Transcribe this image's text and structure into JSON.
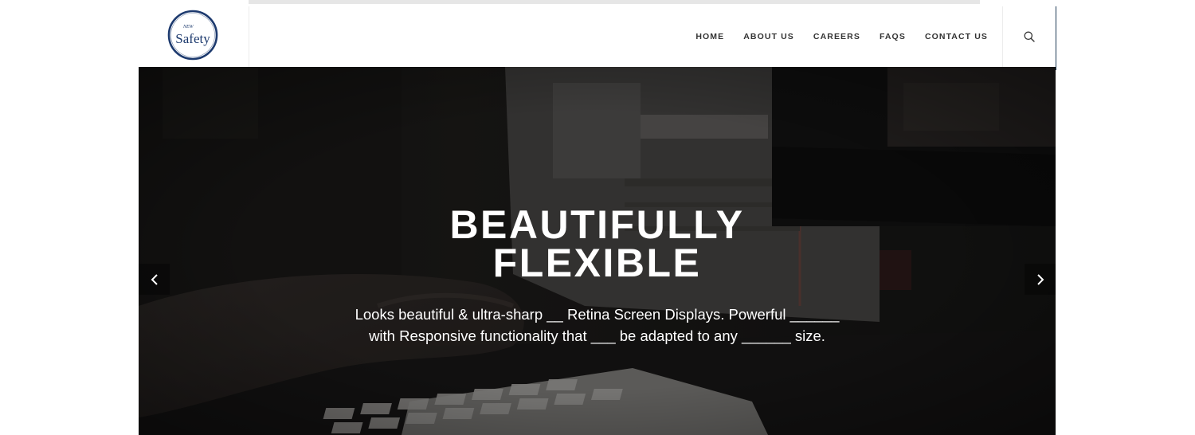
{
  "brand": {
    "logo_small_text": "NEW",
    "logo_text": "Safety",
    "logo_color": "#1d3a6e"
  },
  "nav": {
    "items": [
      {
        "label": "HOME"
      },
      {
        "label": "ABOUT US"
      },
      {
        "label": "CAREERS"
      },
      {
        "label": "FAQS"
      },
      {
        "label": "CONTACT US"
      }
    ],
    "search_icon": "search-icon"
  },
  "hero": {
    "title_line1": "BEAUTIFULLY",
    "title_line2": "FLEXIBLE",
    "text_line1": "Looks beautiful & ultra-sharp __ Retina Screen Displays. Powerful ______",
    "text_line2": "with Responsive functionality that ___ be adapted to any ______ size.",
    "prev_icon": "chevron-left-icon",
    "next_icon": "chevron-right-icon"
  },
  "colors": {
    "accent": "#1d3a55",
    "nav_text": "#333333",
    "hero_text": "#ffffff"
  }
}
